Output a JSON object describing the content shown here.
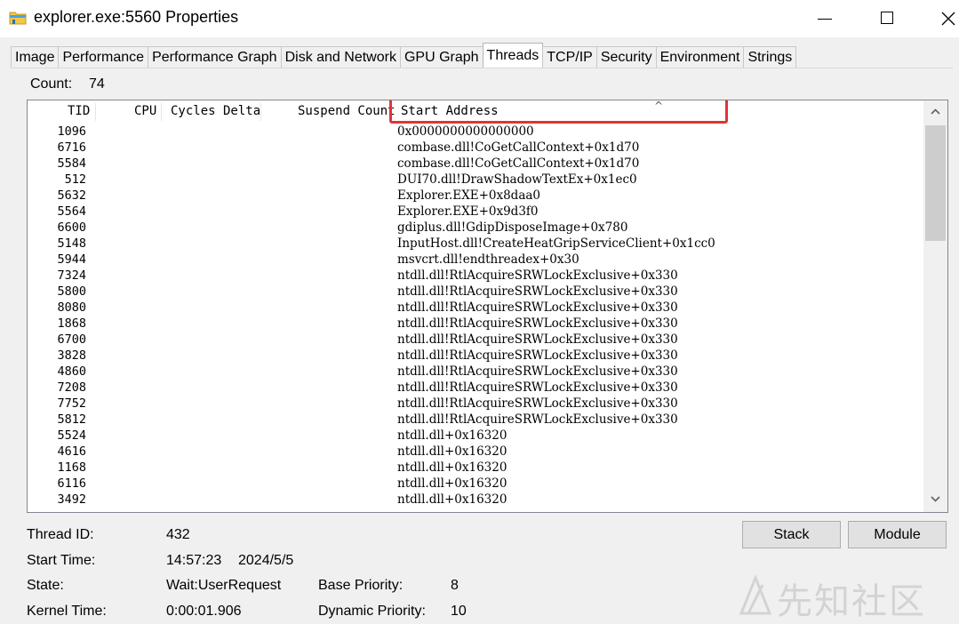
{
  "window": {
    "title": "explorer.exe:5560 Properties"
  },
  "tabs": [
    {
      "label": "Image",
      "active": false
    },
    {
      "label": "Performance",
      "active": false
    },
    {
      "label": "Performance Graph",
      "active": false
    },
    {
      "label": "Disk and Network",
      "active": false
    },
    {
      "label": "GPU Graph",
      "active": false
    },
    {
      "label": "Threads",
      "active": true
    },
    {
      "label": "TCP/IP",
      "active": false
    },
    {
      "label": "Security",
      "active": false
    },
    {
      "label": "Environment",
      "active": false
    },
    {
      "label": "Strings",
      "active": false
    }
  ],
  "count": {
    "label": "Count:",
    "value": "74"
  },
  "columns": {
    "tid": "TID",
    "cpu": "CPU",
    "cycles_delta": "Cycles Delta",
    "suspend_count": "Suspend Count",
    "start_address": "Start Address",
    "sort_indicator": "^"
  },
  "threads": [
    {
      "tid": "1096",
      "start": "0x0000000000000000"
    },
    {
      "tid": "6716",
      "start": "combase.dll!CoGetCallContext+0x1d70"
    },
    {
      "tid": "5584",
      "start": "combase.dll!CoGetCallContext+0x1d70"
    },
    {
      "tid": "512",
      "start": "DUI70.dll!DrawShadowTextEx+0x1ec0"
    },
    {
      "tid": "5632",
      "start": "Explorer.EXE+0x8daa0"
    },
    {
      "tid": "5564",
      "start": "Explorer.EXE+0x9d3f0"
    },
    {
      "tid": "6600",
      "start": "gdiplus.dll!GdipDisposeImage+0x780"
    },
    {
      "tid": "5148",
      "start": "InputHost.dll!CreateHeatGripServiceClient+0x1cc0"
    },
    {
      "tid": "5944",
      "start": "msvcrt.dll!endthreadex+0x30"
    },
    {
      "tid": "7324",
      "start": "ntdll.dll!RtlAcquireSRWLockExclusive+0x330"
    },
    {
      "tid": "5800",
      "start": "ntdll.dll!RtlAcquireSRWLockExclusive+0x330"
    },
    {
      "tid": "8080",
      "start": "ntdll.dll!RtlAcquireSRWLockExclusive+0x330"
    },
    {
      "tid": "1868",
      "start": "ntdll.dll!RtlAcquireSRWLockExclusive+0x330"
    },
    {
      "tid": "6700",
      "start": "ntdll.dll!RtlAcquireSRWLockExclusive+0x330"
    },
    {
      "tid": "3828",
      "start": "ntdll.dll!RtlAcquireSRWLockExclusive+0x330"
    },
    {
      "tid": "4860",
      "start": "ntdll.dll!RtlAcquireSRWLockExclusive+0x330"
    },
    {
      "tid": "7208",
      "start": "ntdll.dll!RtlAcquireSRWLockExclusive+0x330"
    },
    {
      "tid": "7752",
      "start": "ntdll.dll!RtlAcquireSRWLockExclusive+0x330"
    },
    {
      "tid": "5812",
      "start": "ntdll.dll!RtlAcquireSRWLockExclusive+0x330"
    },
    {
      "tid": "5524",
      "start": "ntdll.dll+0x16320"
    },
    {
      "tid": "4616",
      "start": "ntdll.dll+0x16320"
    },
    {
      "tid": "1168",
      "start": "ntdll.dll+0x16320"
    },
    {
      "tid": "6116",
      "start": "ntdll.dll+0x16320"
    },
    {
      "tid": "3492",
      "start": "ntdll.dll+0x16320"
    }
  ],
  "buttons": {
    "stack": "Stack",
    "module": "Module"
  },
  "details": {
    "thread_id_label": "Thread ID:",
    "thread_id_value": "432",
    "start_time_label": "Start Time:",
    "start_time_value": "14:57:23",
    "start_date_value": "2024/5/5",
    "state_label": "State:",
    "state_value": "Wait:UserRequest",
    "base_priority_label": "Base Priority:",
    "base_priority_value": "8",
    "kernel_time_label": "Kernel Time:",
    "kernel_time_value": "0:00:01.906",
    "dynamic_priority_label": "Dynamic Priority:",
    "dynamic_priority_value": "10"
  },
  "watermark": {
    "text": "先知社区"
  },
  "colors": {
    "highlight": "#e03535",
    "window_bg": "#f0f0f0",
    "list_bg": "#ffffff"
  }
}
